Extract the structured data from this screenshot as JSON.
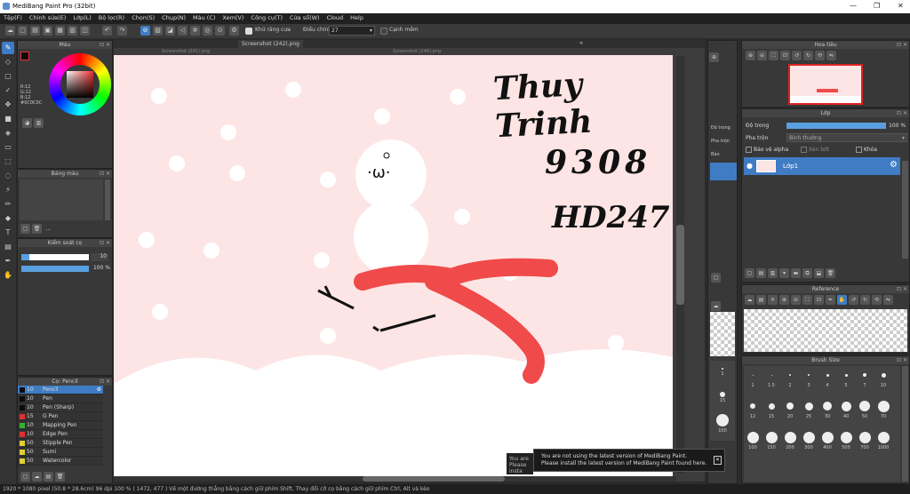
{
  "app": {
    "title": "MediBang Paint Pro (32bit)"
  },
  "menu": [
    "Tệp(F)",
    "Chỉnh sửa(E)",
    "Lớp(L)",
    "Bộ lọc(R)",
    "Chọn(S)",
    "Chụp(N)",
    "Màu (C)",
    "Xem(V)",
    "Công cụ(T)",
    "Cửa sổ(W)",
    "Cloud",
    "Help"
  ],
  "toolbar": {
    "antialias_label": "Khử răng cưa",
    "correction_label": "Điều chỉnh",
    "correction_value": "27",
    "edge_label": "Cạnh mềm"
  },
  "color_panel": {
    "title": "Màu",
    "r": "R:12",
    "g": "G:12",
    "b": "B:12",
    "hex": "#0C0C0C"
  },
  "palette_panel": {
    "title": "Bảng màu"
  },
  "brush_control": {
    "title": "Kiểm soát cọ",
    "size": "10",
    "opacity": "100 %"
  },
  "brush_list": {
    "title": "Cọ: Pencil",
    "items": [
      {
        "size": "10",
        "name": "Pencil",
        "color": "#0c0c0c",
        "selected": true
      },
      {
        "size": "10",
        "name": "Pen",
        "color": "#0c0c0c"
      },
      {
        "size": "10",
        "name": "Pen (Sharp)",
        "color": "#0c0c0c"
      },
      {
        "size": "15",
        "name": "G Pen",
        "color": "#e03030"
      },
      {
        "size": "10",
        "name": "Mapping Pen",
        "color": "#30b030"
      },
      {
        "size": "10",
        "name": "Edge Pen",
        "color": "#e03030"
      },
      {
        "size": "50",
        "name": "Stipple Pen",
        "color": "#e0d030"
      },
      {
        "size": "50",
        "name": "Sumi",
        "color": "#e0d030"
      },
      {
        "size": "50",
        "name": "Watercolor",
        "color": "#e0d030"
      }
    ]
  },
  "canvas": {
    "tab_left": "Screenshot (242).png",
    "tab_ghost_left": "Screenshot (241).png",
    "tab_ghost_right": "Screenshot (240).png",
    "text_line1": "Thuy Trinh",
    "text_line2": "9308",
    "text_line3": "HD247"
  },
  "mid_panel": {
    "label1": "Độ trong",
    "label2": "Pha trộn",
    "label3": "Bảo"
  },
  "navigator": {
    "title": "Hoa tiêu"
  },
  "layer_panel": {
    "title": "Lớp",
    "opacity_label": "Độ trong",
    "opacity_value": "100 %",
    "blend_label": "Pha trộn",
    "blend_value": "Bình thường",
    "protect_alpha": "Bảo vệ alpha",
    "clip": "Xén bớt",
    "lock": "Khóa",
    "layer_name": "Lớp1"
  },
  "reference": {
    "title": "Reference"
  },
  "brush_size": {
    "title": "Brush Size",
    "row1": [
      "1",
      "1.5",
      "2",
      "3",
      "4",
      "5",
      "7",
      "10"
    ],
    "row2": [
      "12",
      "15",
      "20",
      "25",
      "30",
      "40",
      "50",
      "70"
    ],
    "row3": [
      "100",
      "150",
      "200",
      "300",
      "400",
      "500",
      "700",
      "1000"
    ],
    "side": [
      "1",
      "15",
      "100"
    ]
  },
  "notification": {
    "line1": "You are not using the latest version of MediBang Paint.",
    "line2": "Please install the latest version of MediBang Paint found here.",
    "ghost1": "You are",
    "ghost2": "Please insta"
  },
  "status": {
    "text": "1920 * 1080 pixel   (50.8 * 28.6cm)   96 dpi   100 %   ( 1472, 477 )   Vẽ một đường thẳng bằng cách giữ phím Shift, Thay đổi cỡ cọ bằng cách giữ phím Ctrl, Alt và kéo"
  },
  "colors": {
    "accent": "#3f7cc4",
    "canvas_bg": "#fde5e5",
    "scarf": "#f04a4a"
  }
}
